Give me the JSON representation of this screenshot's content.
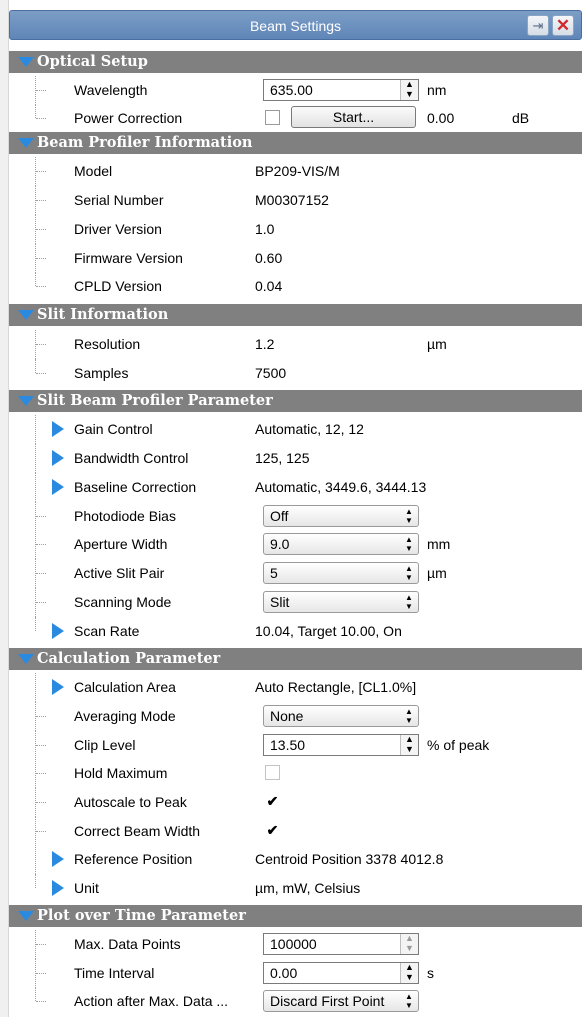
{
  "window": {
    "title": "Beam Settings"
  },
  "colors": {
    "category_bg": "#808080",
    "accent_blue": "#2a8adf",
    "titlebar": "#5f86b8"
  },
  "optical_setup": {
    "header": "Optical Setup",
    "wavelength": {
      "label": "Wavelength",
      "value": "635.00",
      "unit": "nm"
    },
    "power_correction": {
      "label": "Power Correction",
      "checked": false,
      "button": "Start...",
      "value": "0.00",
      "unit": "dB"
    }
  },
  "profiler_info": {
    "header": "Beam Profiler Information",
    "model": {
      "label": "Model",
      "value": "BP209-VIS/M"
    },
    "serial": {
      "label": "Serial Number",
      "value": "M00307152"
    },
    "driver": {
      "label": "Driver Version",
      "value": "1.0"
    },
    "firmware": {
      "label": "Firmware Version",
      "value": "0.60"
    },
    "cpld": {
      "label": "CPLD Version",
      "value": "0.04"
    }
  },
  "slit_info": {
    "header": "Slit Information",
    "resolution": {
      "label": "Resolution",
      "value": "1.2",
      "unit": "µm"
    },
    "samples": {
      "label": "Samples",
      "value": "7500"
    }
  },
  "slit_param": {
    "header": "Slit Beam Profiler Parameter",
    "gain": {
      "label": "Gain Control",
      "value": "Automatic, 12, 12"
    },
    "bandwidth": {
      "label": "Bandwidth Control",
      "value": "125, 125"
    },
    "baseline": {
      "label": "Baseline Correction",
      "value": "Automatic, 3449.6, 3444.13"
    },
    "photodiode": {
      "label": "Photodiode Bias",
      "value": "Off"
    },
    "aperture": {
      "label": "Aperture Width",
      "value": "9.0",
      "unit": "mm"
    },
    "slit_pair": {
      "label": "Active Slit Pair",
      "value": "5",
      "unit": "µm"
    },
    "scanning": {
      "label": "Scanning Mode",
      "value": "Slit"
    },
    "scan_rate": {
      "label": "Scan Rate",
      "value": "10.04, Target 10.00, On"
    }
  },
  "calc_param": {
    "header": "Calculation Parameter",
    "area": {
      "label": "Calculation Area",
      "value": "Auto Rectangle, [CL1.0%]"
    },
    "averaging": {
      "label": "Averaging Mode",
      "value": "None"
    },
    "clip": {
      "label": "Clip Level",
      "value": "13.50",
      "unit": "% of peak"
    },
    "hold_max": {
      "label": "Hold Maximum",
      "checked": false
    },
    "autoscale": {
      "label": "Autoscale to Peak",
      "checked": true,
      "mark": "✔"
    },
    "correct_width": {
      "label": "Correct Beam Width",
      "checked": true,
      "mark": "✔"
    },
    "ref_pos": {
      "label": "Reference Position",
      "value": "Centroid Position 3378 4012.8"
    },
    "unit": {
      "label": "Unit",
      "value": "µm, mW, Celsius"
    }
  },
  "plot_param": {
    "header": "Plot over Time Parameter",
    "max_points": {
      "label": "Max. Data Points",
      "value": "100000"
    },
    "interval": {
      "label": "Time Interval",
      "value": "0.00",
      "unit": "s"
    },
    "action": {
      "label": "Action after Max. Data ...",
      "value": "Discard First Point"
    }
  }
}
